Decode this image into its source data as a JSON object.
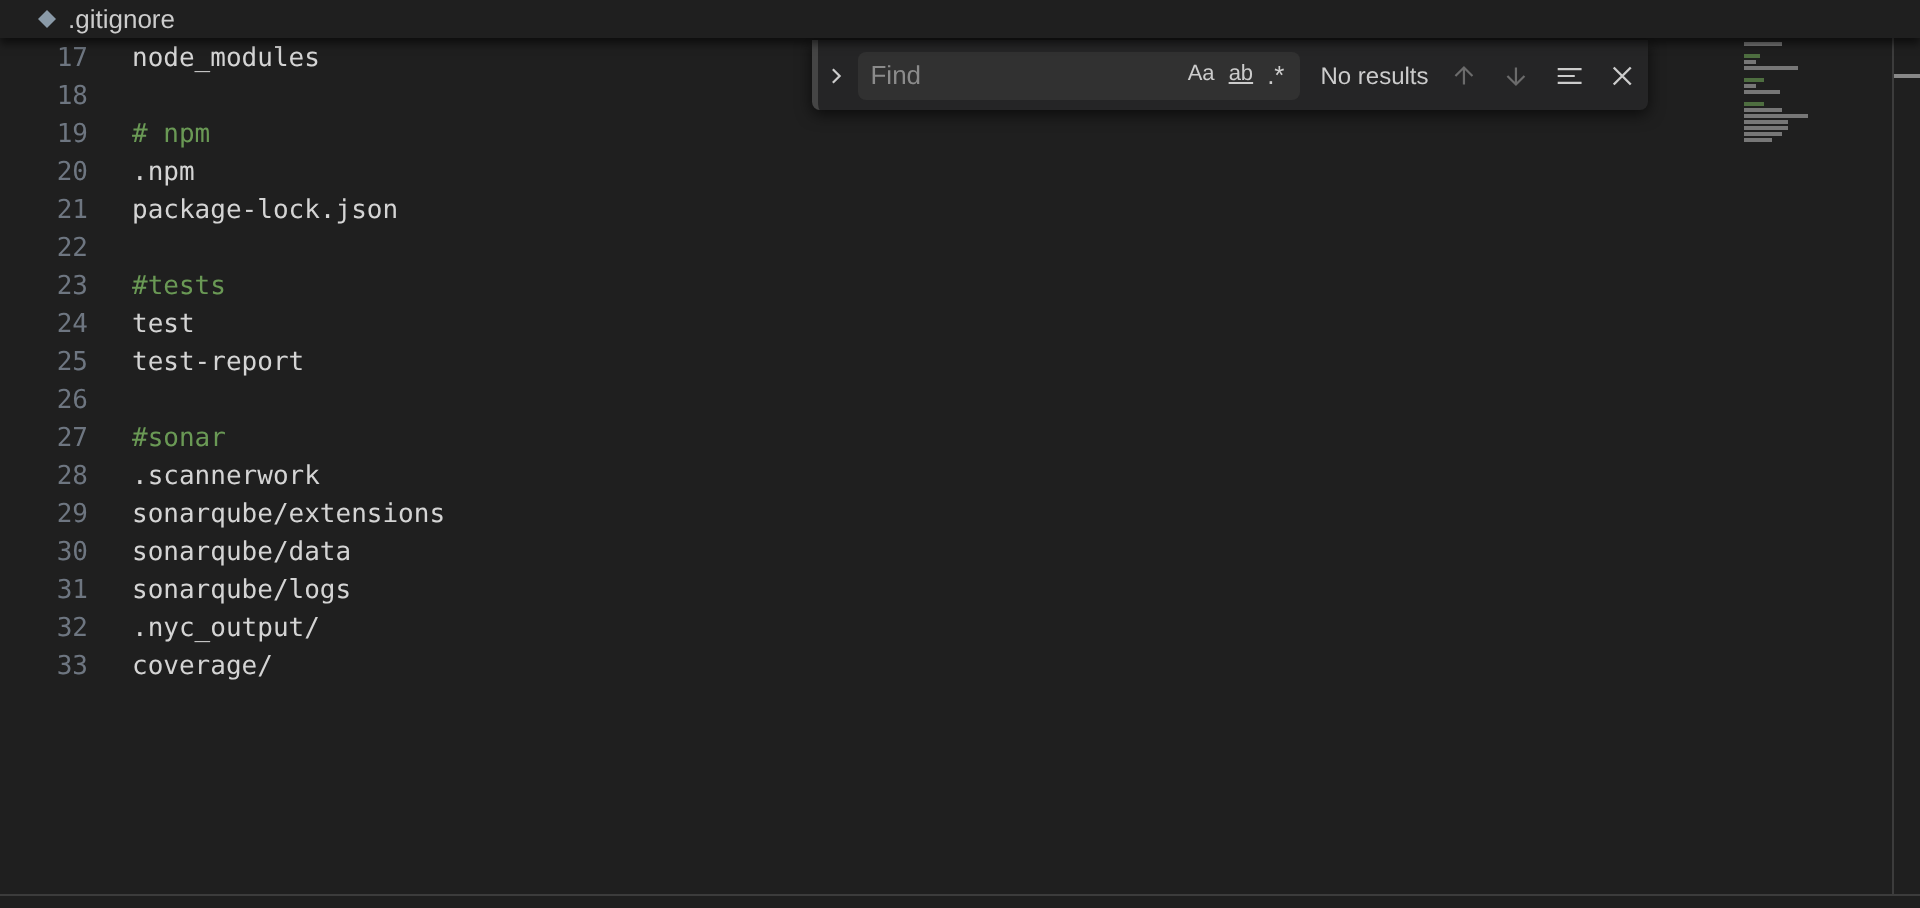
{
  "breadcrumb": {
    "file": ".gitignore"
  },
  "lines": [
    {
      "number": "17",
      "kind": "plain",
      "text": "node_modules"
    },
    {
      "number": "18"
    },
    {
      "number": "19",
      "kind": "comment",
      "text": "# npm"
    },
    {
      "number": "20",
      "kind": "plain",
      "text": ".npm"
    },
    {
      "number": "21",
      "kind": "plain",
      "text": "package-lock.json"
    },
    {
      "number": "22"
    },
    {
      "number": "23",
      "kind": "comment",
      "text": "#tests"
    },
    {
      "number": "24",
      "kind": "plain",
      "text": "test"
    },
    {
      "number": "25",
      "kind": "plain",
      "text": "test-report"
    },
    {
      "number": "26"
    },
    {
      "number": "27",
      "kind": "comment",
      "text": "#sonar"
    },
    {
      "number": "28",
      "kind": "plain",
      "text": ".scannerwork"
    },
    {
      "number": "29",
      "kind": "plain",
      "text": "sonarqube/extensions"
    },
    {
      "number": "30",
      "kind": "plain",
      "text": "sonarqube/data"
    },
    {
      "number": "31",
      "kind": "plain",
      "text": "sonarqube/logs"
    },
    {
      "number": "32",
      "kind": "plain",
      "text": ".nyc_output/"
    },
    {
      "number": "33",
      "kind": "plain",
      "text": "coverage/"
    }
  ],
  "find": {
    "placeholder": "Find",
    "match_case": "Aa",
    "whole_word": "ab",
    "regex": ".*",
    "status": "No results"
  }
}
